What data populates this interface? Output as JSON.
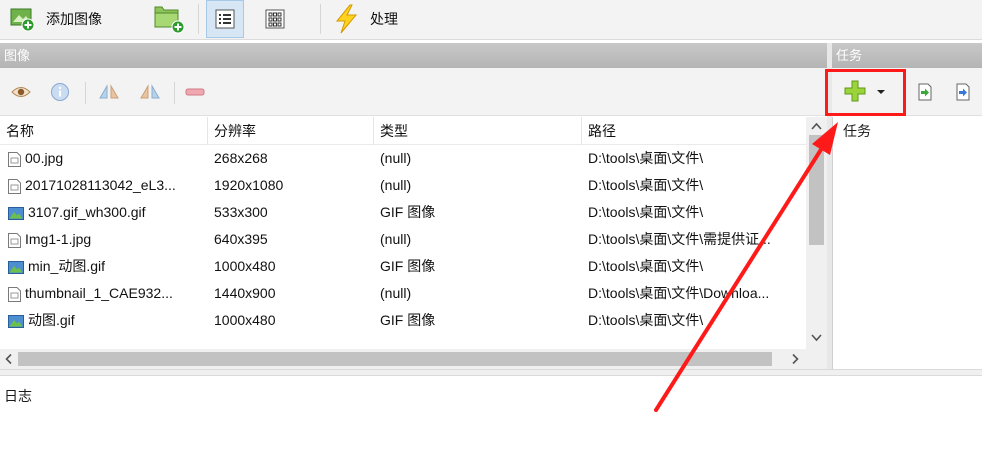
{
  "toolbar": {
    "add_image_label": "添加图像",
    "process_label": "处理"
  },
  "images_panel": {
    "title": "图像",
    "columns": [
      "名称",
      "分辨率",
      "类型",
      "路径"
    ],
    "rows": [
      {
        "name": "00.jpg",
        "resolution": "268x268",
        "type": "(null)",
        "path": "D:\\tools\\桌面\\文件\\",
        "icon": "jpg-file-icon"
      },
      {
        "name": "20171028113042_eL3...",
        "resolution": "1920x1080",
        "type": "(null)",
        "path": "D:\\tools\\桌面\\文件\\",
        "icon": "jpg-file-icon"
      },
      {
        "name": "3107.gif_wh300.gif",
        "resolution": "533x300",
        "type": "GIF 图像",
        "path": "D:\\tools\\桌面\\文件\\",
        "icon": "gif-file-icon"
      },
      {
        "name": "Img1-1.jpg",
        "resolution": "640x395",
        "type": "(null)",
        "path": "D:\\tools\\桌面\\文件\\需提供证...",
        "icon": "jpg-file-icon"
      },
      {
        "name": "min_动图.gif",
        "resolution": "1000x480",
        "type": "GIF 图像",
        "path": "D:\\tools\\桌面\\文件\\",
        "icon": "gif-file-icon"
      },
      {
        "name": "thumbnail_1_CAE932...",
        "resolution": "1440x900",
        "type": "(null)",
        "path": "D:\\tools\\桌面\\文件\\Downloa...",
        "icon": "jpg-file-icon"
      },
      {
        "name": "动图.gif",
        "resolution": "1000x480",
        "type": "GIF 图像",
        "path": "D:\\tools\\桌面\\文件\\",
        "icon": "gif-file-icon"
      }
    ]
  },
  "tasks_panel": {
    "title": "任务",
    "column": "任务"
  },
  "log": {
    "title": "日志"
  },
  "colors": {
    "annotation": "#ff1a1a",
    "panel_header": "#bdbdbd",
    "active_view": "#d6e6f5"
  }
}
